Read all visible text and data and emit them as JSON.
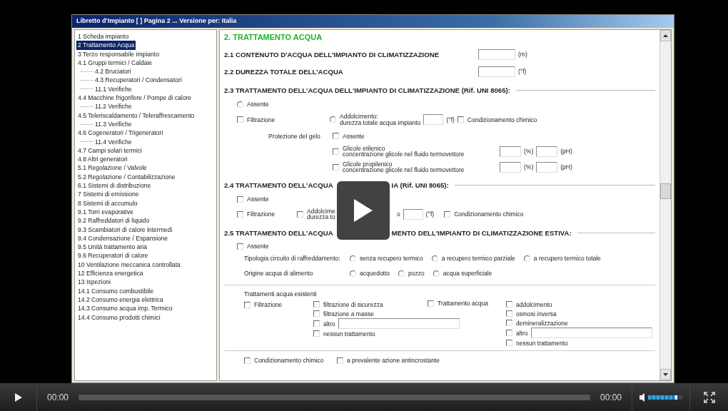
{
  "window": {
    "title": "Libretto d'Impianto [   ] Pagina 2 ... Versione per: Italia"
  },
  "sidebar": {
    "items": [
      {
        "label": "1 Scheda impianto",
        "selected": false
      },
      {
        "label": "2 Trattamento Acqua",
        "selected": true
      },
      {
        "label": "3 Terzo responsabile impianto",
        "selected": false
      },
      {
        "label": "4.1 Gruppi termici / Caldaie",
        "selected": false,
        "children": [
          {
            "label": "4.2 Bruciatori",
            "selected": false
          },
          {
            "label": "4.3 Recuperatori / Condensatori",
            "selected": false
          },
          {
            "label": "11.1 Verifiche",
            "selected": false
          }
        ]
      },
      {
        "label": "4.4 Macchine frigorifere / Pompe di calore",
        "selected": false,
        "children": [
          {
            "label": "11.2 Verifiche",
            "selected": false
          }
        ]
      },
      {
        "label": "4.5 Teleriscaldamento / Teleraffrescamento",
        "selected": false,
        "children": [
          {
            "label": "11.3 Verifiche",
            "selected": false
          }
        ]
      },
      {
        "label": "4.6 Cogeneratori / Trigeneratori",
        "selected": false,
        "children": [
          {
            "label": "11.4 Verifiche",
            "selected": false
          }
        ]
      },
      {
        "label": "4.7 Campi solari termici",
        "selected": false
      },
      {
        "label": "4.8 Altri generatori",
        "selected": false
      },
      {
        "label": "5.1 Regolazione / Valvole",
        "selected": false
      },
      {
        "label": "5.2 Regolazione / Contabilizzazione",
        "selected": false
      },
      {
        "label": "6.1 Sistemi di distribuzione",
        "selected": false
      },
      {
        "label": "7 Sistemi di emissione",
        "selected": false
      },
      {
        "label": "8 Sistemi di accumulo",
        "selected": false
      },
      {
        "label": "9.1 Torri evaporative",
        "selected": false
      },
      {
        "label": "9.2 Raffreddatori di liquido",
        "selected": false
      },
      {
        "label": "9.3 Scambiatori di calore intermedi",
        "selected": false
      },
      {
        "label": "9.4 Condensazione / Espansione",
        "selected": false
      },
      {
        "label": "9.5 Unità trattamento aria",
        "selected": false
      },
      {
        "label": "9.6 Recuperatori di calore",
        "selected": false
      },
      {
        "label": "10 Ventilazione meccanica controllata",
        "selected": false
      },
      {
        "label": "12 Efficienza energetica",
        "selected": false
      },
      {
        "label": "13 Ispezioni",
        "selected": false
      },
      {
        "label": "14.1 Consumo combustibile",
        "selected": false
      },
      {
        "label": "14.2 Consumo energia elettrica",
        "selected": false
      },
      {
        "label": "14.3 Consumo acqua imp. Termico",
        "selected": false
      },
      {
        "label": "14.4 Consumo prodotti chimici",
        "selected": false
      }
    ]
  },
  "form": {
    "title": "2. TRATTAMENTO ACQUA",
    "water_content": {
      "label": "2.1 CONTENUTO D'ACQUA DELL'IMPIANTO DI CLIMATIZZAZIONE",
      "unit": "(m)"
    },
    "hardness": {
      "label": "2.2 DUREZZA TOTALE DELL'ACQUA",
      "unit": "(°f)"
    },
    "s23": {
      "heading": "2.3 TRATTAMENTO DELL'ACQUA DELL'IMPIANTO DI CLIMATIZZAZIONE (Rif. UNI 8065):",
      "absent": {
        "label": "Assente",
        "selected": false
      },
      "filtration": {
        "label": "Filtrazione",
        "checked": false
      },
      "softening": {
        "label": "Addolcimento:",
        "sub": "durezza totale acqua impianto",
        "selected": false,
        "unit": "(°f)"
      },
      "chemical": {
        "label": "Condizionamento chimico",
        "checked": false
      },
      "frost_label": "Protezione del gelo",
      "frost_absent": {
        "label": "Assente",
        "checked": false
      },
      "glycols": [
        {
          "label": "Glicole etilenico",
          "sub": "concentrazione glicole nel fluido termovettore",
          "checked": false,
          "unit_1": "(%)",
          "unit_2": "(pH)"
        },
        {
          "label": "Glicole propilenico",
          "sub": "concentrazione glicole nel fluido termovettore",
          "checked": false,
          "unit_1": "(%)",
          "unit_2": "(pH)"
        }
      ]
    },
    "s24": {
      "heading_before": "2.4 TRATTAMENTO DELL'ACQUA",
      "heading_after": "IA (Rif. UNI 8065):",
      "absent": {
        "label": "Assente",
        "checked": false
      },
      "filtration": {
        "label": "Filtrazione",
        "checked": false
      },
      "softening": {
        "label": "Addolcime",
        "sub": "durezza to",
        "checked": false,
        "tail": "o",
        "unit": "(°f)"
      },
      "chemical": {
        "label": "Condizionamento chimico",
        "checked": false
      }
    },
    "s25": {
      "heading_before": "2.5 TRATTAMENTO DELL'ACQUA",
      "heading_after": "MENTO DELL'IMPIANTO DI CLIMATIZZAZIONE ESTIVA:",
      "absent": {
        "label": "Assente",
        "checked": false
      },
      "circuit": {
        "label": "Tipologia circuito di raffreddamento:",
        "options": [
          {
            "label": "senza recupero termico",
            "selected": false
          },
          {
            "label": "a recupero termico parziale",
            "selected": false
          },
          {
            "label": "a recupero termico totale",
            "selected": false
          }
        ]
      },
      "source": {
        "label": "Origine acqua di alimento",
        "options": [
          {
            "label": "acquedotto",
            "selected": false
          },
          {
            "label": "pozzo",
            "selected": false
          },
          {
            "label": "acqua superficiale",
            "selected": false
          }
        ]
      },
      "existing": {
        "label": "Trattamenti acqua esistenti",
        "filtration": {
          "label": "Filtrazione",
          "checked": false
        },
        "filtration_options": [
          {
            "kind": "check",
            "label": "filtrazione di sicurezza",
            "checked": false
          },
          {
            "kind": "check",
            "label": "filtrazione a masse",
            "checked": false
          },
          {
            "kind": "check_field",
            "label": "altro",
            "checked": false
          },
          {
            "kind": "check",
            "label": "nessun trattamento",
            "checked": false
          }
        ],
        "treatment": {
          "label": "Trattamento acqua",
          "checked": false
        },
        "treatment_options": [
          {
            "kind": "check",
            "label": "addolcimento",
            "checked": false
          },
          {
            "kind": "check",
            "label": "osmosi inversa",
            "checked": false
          },
          {
            "kind": "check",
            "label": "demineralizzazione",
            "checked": false
          },
          {
            "kind": "check_field",
            "label": "altro",
            "checked": false
          },
          {
            "kind": "check",
            "label": "nessun trattamento",
            "checked": false
          }
        ]
      },
      "chemical": {
        "label": "Condizionamento chimico",
        "checked": false
      },
      "antiscale": {
        "label": "a prevalente azione antincrostante",
        "checked": false
      }
    }
  },
  "player": {
    "elapsed": "00:00",
    "duration": "00:00",
    "progress": {
      "level": 0
    },
    "volume": {
      "level": 0.85
    }
  }
}
